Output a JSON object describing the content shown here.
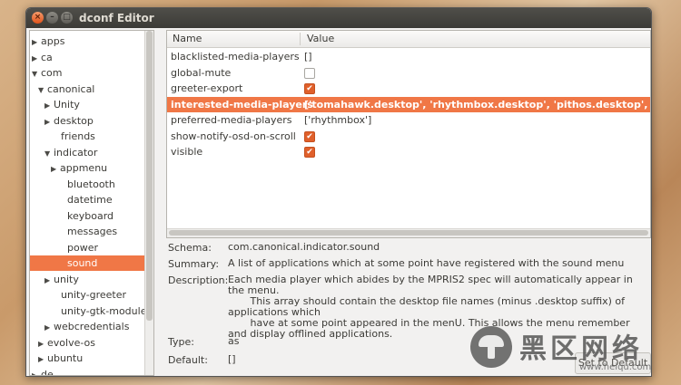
{
  "window": {
    "title": "dconf Editor"
  },
  "tree": {
    "nodes": [
      {
        "label": "apps",
        "twisty": "▶",
        "indent": 0
      },
      {
        "label": "ca",
        "twisty": "▶",
        "indent": 0
      },
      {
        "label": "com",
        "twisty": "▼",
        "indent": 0
      },
      {
        "label": "canonical",
        "twisty": "▼",
        "indent": 1
      },
      {
        "label": "Unity",
        "twisty": "▶",
        "indent": 2
      },
      {
        "label": "desktop",
        "twisty": "▶",
        "indent": 2
      },
      {
        "label": "friends",
        "twisty": "",
        "indent": 2
      },
      {
        "label": "indicator",
        "twisty": "▼",
        "indent": 2
      },
      {
        "label": "appmenu",
        "twisty": "▶",
        "indent": 3
      },
      {
        "label": "bluetooth",
        "twisty": "",
        "indent": 3
      },
      {
        "label": "datetime",
        "twisty": "",
        "indent": 3
      },
      {
        "label": "keyboard",
        "twisty": "",
        "indent": 3
      },
      {
        "label": "messages",
        "twisty": "",
        "indent": 3
      },
      {
        "label": "power",
        "twisty": "",
        "indent": 3
      },
      {
        "label": "sound",
        "twisty": "",
        "indent": 3,
        "selected": true
      },
      {
        "label": "unity",
        "twisty": "▶",
        "indent": 2
      },
      {
        "label": "unity-greeter",
        "twisty": "",
        "indent": 2
      },
      {
        "label": "unity-gtk-module",
        "twisty": "",
        "indent": 2
      },
      {
        "label": "webcredentials",
        "twisty": "▶",
        "indent": 2
      },
      {
        "label": "evolve-os",
        "twisty": "▶",
        "indent": 1
      },
      {
        "label": "ubuntu",
        "twisty": "▶",
        "indent": 1
      },
      {
        "label": "de",
        "twisty": "▶",
        "indent": 0
      }
    ]
  },
  "list": {
    "headers": {
      "name": "Name",
      "value": "Value"
    },
    "rows": [
      {
        "name": "blacklisted-media-players",
        "type": "text",
        "value": "[]"
      },
      {
        "name": "global-mute",
        "type": "check",
        "checked": false
      },
      {
        "name": "greeter-export",
        "type": "check",
        "checked": true
      },
      {
        "name": "interested-media-players",
        "type": "text",
        "value": "['tomahawk.desktop', 'rhythmbox.desktop', 'pithos.desktop', 'clementine.",
        "selected": true
      },
      {
        "name": "preferred-media-players",
        "type": "text",
        "value": "['rhythmbox']"
      },
      {
        "name": "show-notify-osd-on-scroll",
        "type": "check",
        "checked": true
      },
      {
        "name": "visible",
        "type": "check",
        "checked": true
      }
    ]
  },
  "details": {
    "schema_label": "Schema:",
    "schema_value": "com.canonical.indicator.sound",
    "summary_label": "Summary:",
    "summary_value": "A list of applications which at some point have registered with the sound menu",
    "description_label": "Description:",
    "description_value": "Each media player which abides by the MPRIS2 spec will automatically appear in the menu.\n       This array should contain the desktop file names (minus .desktop suffix) of applications which\n       have at some point appeared in the menU. This allows the menu remember and display offlined applications.",
    "type_label": "Type:",
    "type_value": "as",
    "default_label": "Default:",
    "default_value": "[]",
    "set_default_label": "Set to Default"
  },
  "watermark": {
    "text": "黑区网络",
    "url": "www.heiqu.com"
  }
}
